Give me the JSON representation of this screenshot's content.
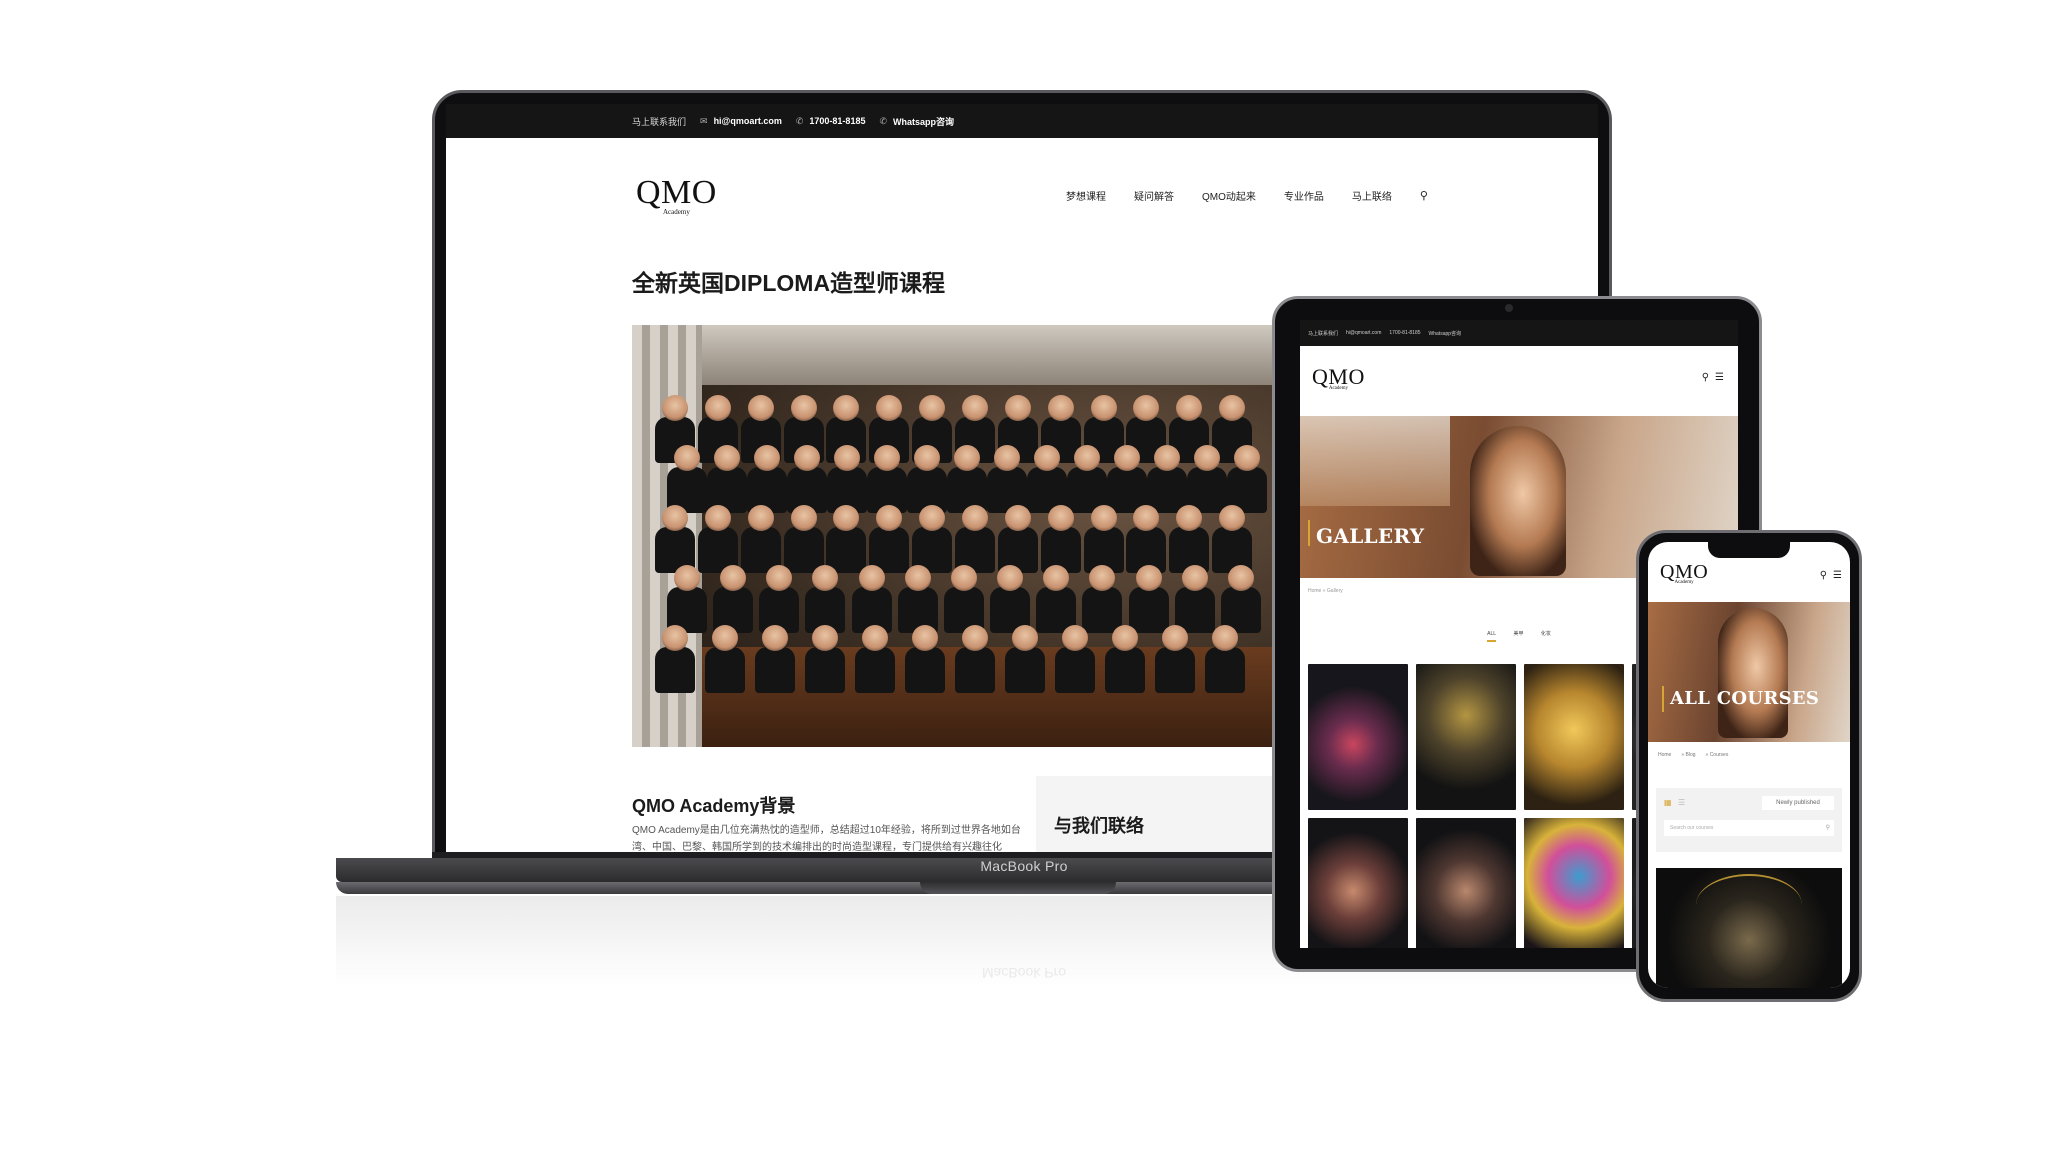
{
  "laptop": {
    "topbar": {
      "contact_label": "马上联系我们",
      "email": "hi@qmoart.com",
      "phone": "1700-81-8185",
      "whatsapp": "Whatsapp咨询"
    },
    "logo": {
      "main": "QMO",
      "sub": "Academy"
    },
    "nav": [
      "梦想课程",
      "疑问解答",
      "QMO动起来",
      "专业作品",
      "马上联络"
    ],
    "page_title": "全新英国DIPLOMA造型师课程",
    "section_heading": "QMO Academy背景",
    "section_paragraph": "QMO Academy是由几位充满热忱的造型师，总结超过10年经验，将所到过世界各地如台湾、中国、巴黎、韩国所学到的技术编排出的时尚造型课程，专门提供给有兴趣往化",
    "contact_heading": "与我们联络",
    "device_label": "MacBook Pro"
  },
  "tablet": {
    "topbar": {
      "contact_label": "马上联系我们",
      "email": "hi@qmoart.com",
      "phone": "1700-81-8185",
      "whatsapp": "Whatsapp咨询"
    },
    "logo": {
      "main": "QMO",
      "sub": "Academy"
    },
    "banner_title": "GALLERY",
    "breadcrumb": [
      "Home",
      "» Gallery"
    ],
    "filters": [
      "ALL",
      "美甲",
      "化妆"
    ]
  },
  "phone": {
    "logo": {
      "main": "QMO",
      "sub": "Academy"
    },
    "banner_title": "ALL COURSES",
    "breadcrumb": [
      "Home",
      "» Blog",
      "» Courses"
    ],
    "sort_select": "Newly published",
    "search_placeholder": "Search our courses"
  },
  "icons": {
    "email": "envelope-icon",
    "phone": "phone-icon",
    "search": "search-icon",
    "menu": "hamburger-icon",
    "grid_view": "grid-view-icon",
    "list_view": "list-view-icon"
  },
  "colors": {
    "accent": "#d7a531",
    "topbar": "#151515"
  }
}
